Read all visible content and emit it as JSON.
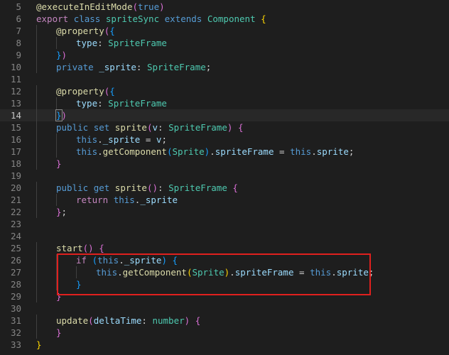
{
  "editor": {
    "language": "TypeScript",
    "active_line": 14,
    "highlight_color": "#e0201e",
    "lines": [
      {
        "num": "5",
        "indent": 0,
        "tokens": [
          {
            "t": "@",
            "c": "dec"
          },
          {
            "t": "executeInEditMode",
            "c": "func"
          },
          {
            "t": "(",
            "c": "br2"
          },
          {
            "t": "true",
            "c": "kw"
          },
          {
            "t": ")",
            "c": "br2"
          }
        ]
      },
      {
        "num": "6",
        "indent": 0,
        "tokens": [
          {
            "t": "export ",
            "c": "ctl"
          },
          {
            "t": "class ",
            "c": "kw"
          },
          {
            "t": "spriteSync ",
            "c": "type"
          },
          {
            "t": "extends ",
            "c": "kw"
          },
          {
            "t": "Component ",
            "c": "type"
          },
          {
            "t": "{",
            "c": "br1"
          }
        ]
      },
      {
        "num": "7",
        "indent": 1,
        "tokens": [
          {
            "t": "@",
            "c": "dec"
          },
          {
            "t": "property",
            "c": "func"
          },
          {
            "t": "(",
            "c": "br2"
          },
          {
            "t": "{",
            "c": "br3"
          }
        ]
      },
      {
        "num": "8",
        "indent": 2,
        "tokens": [
          {
            "t": "type",
            "c": "var"
          },
          {
            "t": ": ",
            "c": "plain"
          },
          {
            "t": "SpriteFrame",
            "c": "type"
          }
        ]
      },
      {
        "num": "9",
        "indent": 1,
        "tokens": [
          {
            "t": "}",
            "c": "br3"
          },
          {
            "t": ")",
            "c": "br2"
          }
        ]
      },
      {
        "num": "10",
        "indent": 1,
        "tokens": [
          {
            "t": "private ",
            "c": "kw"
          },
          {
            "t": "_sprite",
            "c": "var"
          },
          {
            "t": ": ",
            "c": "plain"
          },
          {
            "t": "SpriteFrame",
            "c": "type"
          },
          {
            "t": ";",
            "c": "plain"
          }
        ]
      },
      {
        "num": "11",
        "indent": 0,
        "tokens": []
      },
      {
        "num": "12",
        "indent": 1,
        "tokens": [
          {
            "t": "@",
            "c": "dec"
          },
          {
            "t": "property",
            "c": "func"
          },
          {
            "t": "(",
            "c": "br2"
          },
          {
            "t": "{",
            "c": "br3"
          }
        ]
      },
      {
        "num": "13",
        "indent": 2,
        "tokens": [
          {
            "t": "type",
            "c": "var"
          },
          {
            "t": ": ",
            "c": "plain"
          },
          {
            "t": "SpriteFrame",
            "c": "type"
          }
        ]
      },
      {
        "num": "14",
        "indent": 1,
        "tokens": [
          {
            "t": "}",
            "c": "br3"
          },
          {
            "t": ")",
            "c": "br2"
          }
        ]
      },
      {
        "num": "15",
        "indent": 1,
        "tokens": [
          {
            "t": "public ",
            "c": "kw"
          },
          {
            "t": "set ",
            "c": "kw"
          },
          {
            "t": "sprite",
            "c": "func"
          },
          {
            "t": "(",
            "c": "br2"
          },
          {
            "t": "v",
            "c": "var"
          },
          {
            "t": ": ",
            "c": "plain"
          },
          {
            "t": "SpriteFrame",
            "c": "type"
          },
          {
            "t": ") ",
            "c": "br2"
          },
          {
            "t": "{",
            "c": "br2"
          }
        ]
      },
      {
        "num": "16",
        "indent": 2,
        "tokens": [
          {
            "t": "this",
            "c": "kw"
          },
          {
            "t": ".",
            "c": "plain"
          },
          {
            "t": "_sprite",
            "c": "var"
          },
          {
            "t": " = ",
            "c": "plain"
          },
          {
            "t": "v",
            "c": "var"
          },
          {
            "t": ";",
            "c": "plain"
          }
        ]
      },
      {
        "num": "17",
        "indent": 2,
        "tokens": [
          {
            "t": "this",
            "c": "kw"
          },
          {
            "t": ".",
            "c": "plain"
          },
          {
            "t": "getComponent",
            "c": "func"
          },
          {
            "t": "(",
            "c": "br3"
          },
          {
            "t": "Sprite",
            "c": "type"
          },
          {
            "t": ")",
            "c": "br3"
          },
          {
            "t": ".",
            "c": "plain"
          },
          {
            "t": "spriteFrame",
            "c": "var"
          },
          {
            "t": " = ",
            "c": "plain"
          },
          {
            "t": "this",
            "c": "kw"
          },
          {
            "t": ".",
            "c": "plain"
          },
          {
            "t": "sprite",
            "c": "var"
          },
          {
            "t": ";",
            "c": "plain"
          }
        ]
      },
      {
        "num": "18",
        "indent": 1,
        "tokens": [
          {
            "t": "}",
            "c": "br2"
          }
        ]
      },
      {
        "num": "19",
        "indent": 0,
        "tokens": []
      },
      {
        "num": "20",
        "indent": 1,
        "tokens": [
          {
            "t": "public ",
            "c": "kw"
          },
          {
            "t": "get ",
            "c": "kw"
          },
          {
            "t": "sprite",
            "c": "func"
          },
          {
            "t": "(",
            "c": "br2"
          },
          {
            "t": ")",
            "c": "br2"
          },
          {
            "t": ": ",
            "c": "plain"
          },
          {
            "t": "SpriteFrame ",
            "c": "type"
          },
          {
            "t": "{",
            "c": "br2"
          }
        ]
      },
      {
        "num": "21",
        "indent": 2,
        "tokens": [
          {
            "t": "return ",
            "c": "ctl"
          },
          {
            "t": "this",
            "c": "kw"
          },
          {
            "t": ".",
            "c": "plain"
          },
          {
            "t": "_sprite",
            "c": "var"
          }
        ]
      },
      {
        "num": "22",
        "indent": 1,
        "tokens": [
          {
            "t": "}",
            "c": "br2"
          },
          {
            "t": ";",
            "c": "plain"
          }
        ]
      },
      {
        "num": "23",
        "indent": 0,
        "tokens": []
      },
      {
        "num": "24",
        "indent": 0,
        "tokens": []
      },
      {
        "num": "25",
        "indent": 1,
        "tokens": [
          {
            "t": "start",
            "c": "func"
          },
          {
            "t": "(",
            "c": "br2"
          },
          {
            "t": ")",
            "c": "br2"
          },
          {
            "t": " ",
            "c": "plain"
          },
          {
            "t": "{",
            "c": "br2"
          }
        ]
      },
      {
        "num": "26",
        "indent": 2,
        "tokens": [
          {
            "t": "if ",
            "c": "ctl"
          },
          {
            "t": "(",
            "c": "br3"
          },
          {
            "t": "this",
            "c": "kw"
          },
          {
            "t": ".",
            "c": "plain"
          },
          {
            "t": "_sprite",
            "c": "var"
          },
          {
            "t": ")",
            "c": "br3"
          },
          {
            "t": " ",
            "c": "plain"
          },
          {
            "t": "{",
            "c": "br3"
          }
        ]
      },
      {
        "num": "27",
        "indent": 3,
        "tokens": [
          {
            "t": "this",
            "c": "kw"
          },
          {
            "t": ".",
            "c": "plain"
          },
          {
            "t": "getComponent",
            "c": "func"
          },
          {
            "t": "(",
            "c": "br1"
          },
          {
            "t": "Sprite",
            "c": "type"
          },
          {
            "t": ")",
            "c": "br1"
          },
          {
            "t": ".",
            "c": "plain"
          },
          {
            "t": "spriteFrame",
            "c": "var"
          },
          {
            "t": " = ",
            "c": "plain"
          },
          {
            "t": "this",
            "c": "kw"
          },
          {
            "t": ".",
            "c": "plain"
          },
          {
            "t": "sprite",
            "c": "var"
          },
          {
            "t": ";",
            "c": "plain"
          }
        ]
      },
      {
        "num": "28",
        "indent": 2,
        "tokens": [
          {
            "t": "}",
            "c": "br3"
          }
        ]
      },
      {
        "num": "29",
        "indent": 1,
        "tokens": [
          {
            "t": "}",
            "c": "br2"
          }
        ]
      },
      {
        "num": "30",
        "indent": 0,
        "tokens": []
      },
      {
        "num": "31",
        "indent": 1,
        "tokens": [
          {
            "t": "update",
            "c": "func"
          },
          {
            "t": "(",
            "c": "br2"
          },
          {
            "t": "deltaTime",
            "c": "var"
          },
          {
            "t": ": ",
            "c": "plain"
          },
          {
            "t": "number",
            "c": "type"
          },
          {
            "t": ")",
            "c": "br2"
          },
          {
            "t": " ",
            "c": "plain"
          },
          {
            "t": "{",
            "c": "br2"
          }
        ]
      },
      {
        "num": "32",
        "indent": 1,
        "tokens": [
          {
            "t": "}",
            "c": "br2"
          }
        ]
      },
      {
        "num": "33",
        "indent": 0,
        "tokens": [
          {
            "t": "}",
            "c": "br1"
          }
        ]
      }
    ]
  }
}
